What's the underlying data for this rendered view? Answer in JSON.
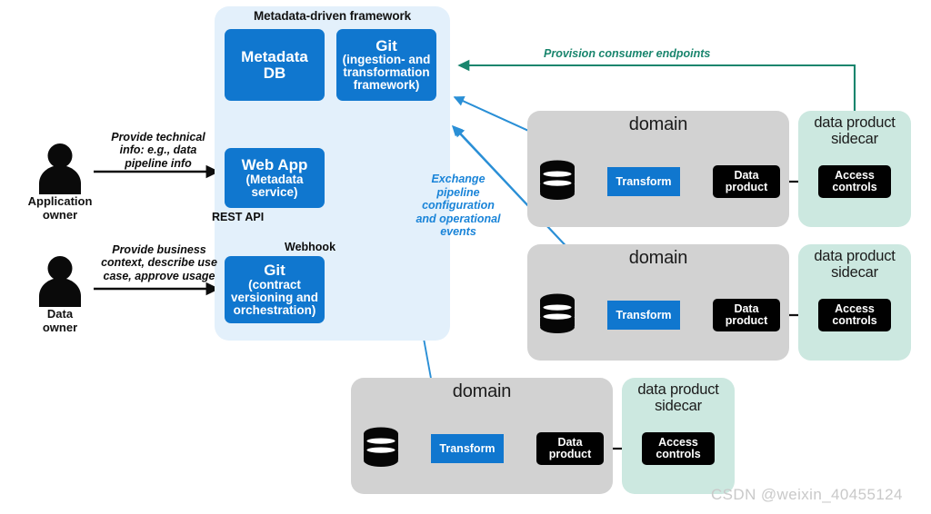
{
  "framework": {
    "title": "Metadata-driven framework",
    "boxes": {
      "metadata_db": {
        "main": "Metadata",
        "sub_line1": "DB"
      },
      "git_top": {
        "main": "Git",
        "sub_line1": "(ingestion- and",
        "sub_line2": "transformation",
        "sub_line3": "framework)"
      },
      "web_app": {
        "main": "Web App",
        "sub_line1": "(Metadata",
        "sub_line2": "service)"
      },
      "git_bottom": {
        "main": "Git",
        "sub_line1": "(contract",
        "sub_line2": "versioning and",
        "sub_line3": "orchestration)"
      }
    },
    "connector_labels": {
      "rest_api": "REST API",
      "webhook": "Webhook"
    }
  },
  "actors": [
    {
      "id": "application-owner",
      "label_line1": "Application",
      "label_line2": "owner",
      "message_line1": "Provide technical",
      "message_line2": "info: e.g., data",
      "message_line3": "pipeline info"
    },
    {
      "id": "data-owner",
      "label_line1": "Data",
      "label_line2": "owner",
      "message_line1": "Provide business",
      "message_line2": "context, describe use",
      "message_line3": "case, approve usage"
    }
  ],
  "annotations": {
    "provision": "Provision consumer endpoints",
    "exchange_line1": "Exchange",
    "exchange_line2": "pipeline",
    "exchange_line3": "configuration",
    "exchange_line4": "and operational",
    "exchange_line5": "events"
  },
  "domains": [
    {
      "id": "domain-1",
      "title": "domain",
      "source_icon": "database-icon",
      "transform": "Transform",
      "data_product_line1": "Data",
      "data_product_line2": "product",
      "sidecar": {
        "title_line1": "data product",
        "title_line2": "sidecar",
        "access_line1": "Access",
        "access_line2": "controls"
      }
    },
    {
      "id": "domain-2",
      "title": "domain",
      "source_icon": "database-icon",
      "transform": "Transform",
      "data_product_line1": "Data",
      "data_product_line2": "product",
      "sidecar": {
        "title_line1": "data product",
        "title_line2": "sidecar",
        "access_line1": "Access",
        "access_line2": "controls"
      }
    },
    {
      "id": "domain-3",
      "title": "domain",
      "source_icon": "database-icon",
      "transform": "Transform",
      "data_product_line1": "Data",
      "data_product_line2": "product",
      "sidecar": {
        "title_line1": "data product",
        "title_line2": "sidecar",
        "access_line1": "Access",
        "access_line2": "controls"
      }
    }
  ],
  "watermark": "CSDN @weixin_40455124",
  "colors": {
    "framework_panel": "#e3f0fb",
    "blue_box": "#1077cf",
    "domain_gray": "#d2d2d2",
    "sidecar_green": "#cce8e0",
    "black_node": "#010101",
    "blue_arrow": "#2a8fd6",
    "green_arrow": "#19856d"
  }
}
